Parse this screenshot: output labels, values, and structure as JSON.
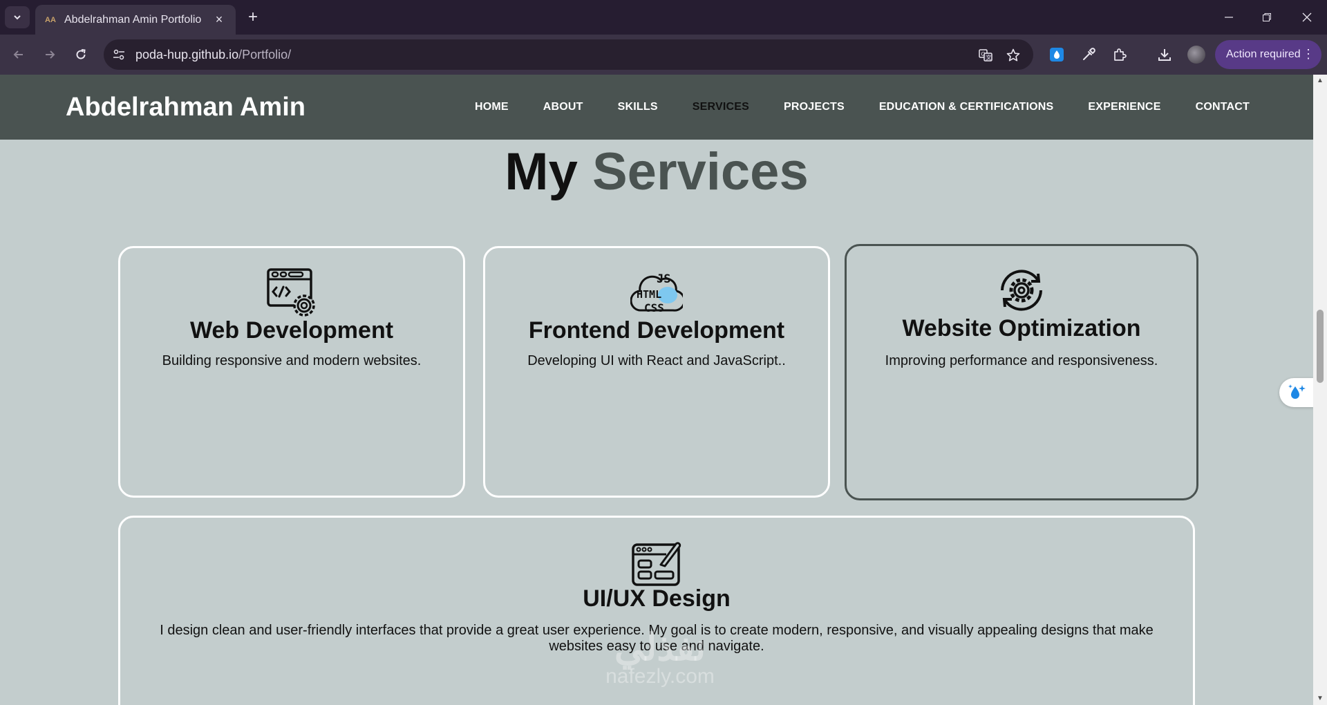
{
  "browser": {
    "tab_title": "Abdelrahman Amin Portfolio",
    "url_host": "poda-hup.github.io",
    "url_path": "/Portfolio/",
    "action_label": "Action required"
  },
  "site": {
    "brand": "Abdelrahman Amin",
    "nav": [
      "HOME",
      "ABOUT",
      "SKILLS",
      "SERVICES",
      "PROJECTS",
      "EDUCATION & CERTIFICATIONS",
      "EXPERIENCE",
      "CONTACT"
    ],
    "active_nav": "SERVICES"
  },
  "services": {
    "title_part1": "My",
    "title_part2": "Services",
    "cards": [
      {
        "icon": "web-code-settings-icon",
        "title": "Web Development",
        "desc": "Building responsive and modern websites."
      },
      {
        "icon": "js-html-css-cloud-icon",
        "title": "Frontend Development",
        "desc": "Developing UI with React and JavaScript.."
      },
      {
        "icon": "gear-refresh-icon",
        "title": "Website Optimization",
        "desc": "Improving performance and responsiveness."
      },
      {
        "icon": "ui-design-brush-icon",
        "title": "UI/UX Design",
        "desc": "I design clean and user-friendly interfaces that provide a great user experience. My goal is to create modern, responsive, and visually appealing designs that make websites easy to use and navigate."
      }
    ]
  },
  "watermark": {
    "arabic": "نفذلي",
    "latin": "nafezly.com"
  },
  "colors": {
    "page_bg": "#c3cdcd",
    "header_bg": "#4a5351",
    "accent": "#4a5351",
    "card_border": "#ffffff",
    "action_btn": "#583a87"
  }
}
